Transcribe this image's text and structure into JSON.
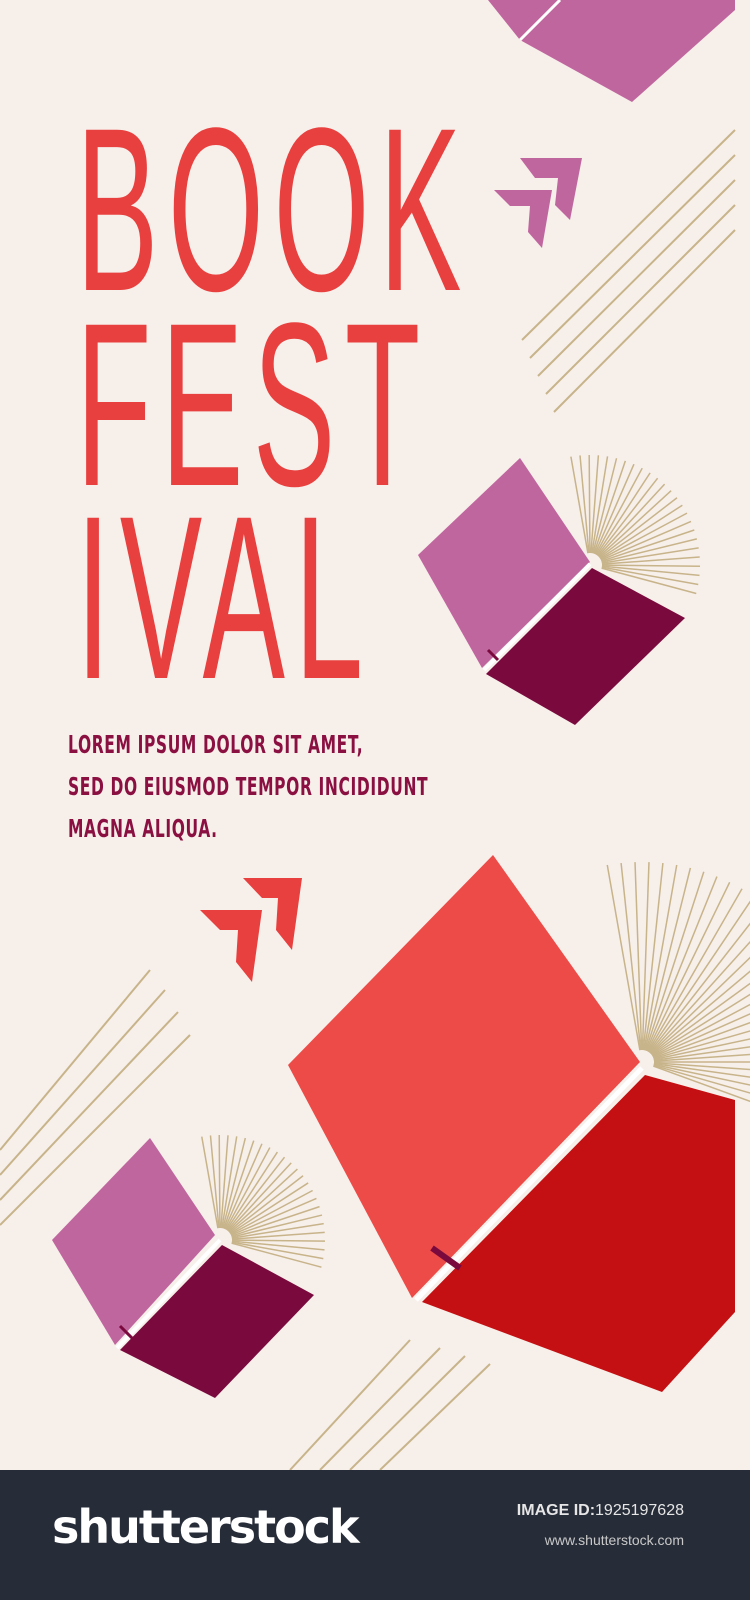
{
  "poster": {
    "title_lines": [
      "BOOK",
      "FEST",
      "IVAL"
    ],
    "subtitle_lines": [
      "LOREM IPSUM DOLOR SIT AMET,",
      "SED DO EIUSMOD TEMPOR INCIDIDUNT",
      "MAGNA ALIQUA."
    ],
    "colors": {
      "background": "#f7efea",
      "title": "#e8403f",
      "subtitle": "#8b1042",
      "purple": "#c0669f",
      "plum": "#7a0a3e",
      "red_light": "#ec4b47",
      "red_dark": "#c41012",
      "lines": "#c8b48a"
    }
  },
  "footer": {
    "logo": "shutterstock",
    "image_id_label": "IMAGE ID:",
    "image_id": "1925197628",
    "site": "www.shutterstock.com"
  }
}
